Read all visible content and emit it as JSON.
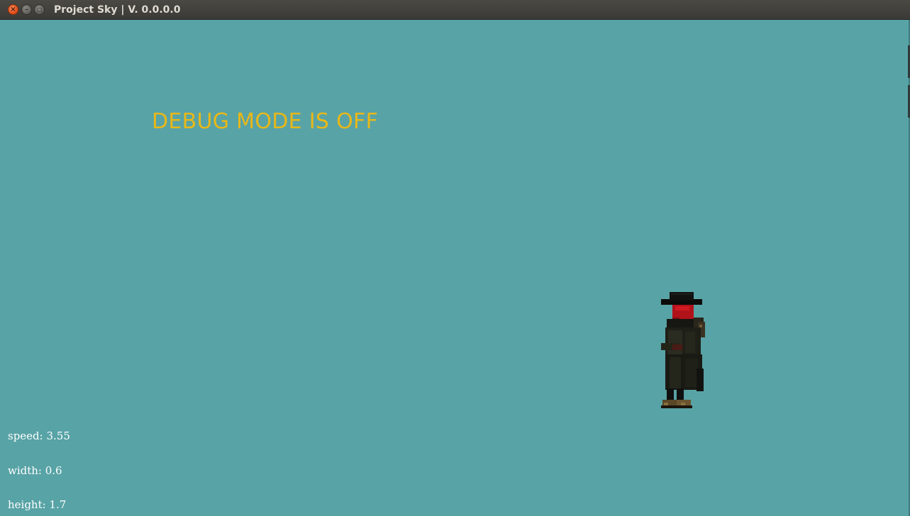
{
  "window": {
    "title": "Project Sky | V. 0.0.0.0",
    "buttons": {
      "close_icon": "close-icon",
      "minimize_icon": "minimize-icon",
      "maximize_icon": "maximize-icon"
    }
  },
  "game": {
    "background_color": "#58a3a6",
    "debug_message": "DEBUG MODE IS OFF",
    "debug_color": "#e8b818",
    "player": {
      "sprite": "cowboy-with-red-bandana"
    },
    "stats": {
      "speed": "speed: 3.55",
      "width": "width: 0.6",
      "height": "height: 1.7"
    }
  }
}
